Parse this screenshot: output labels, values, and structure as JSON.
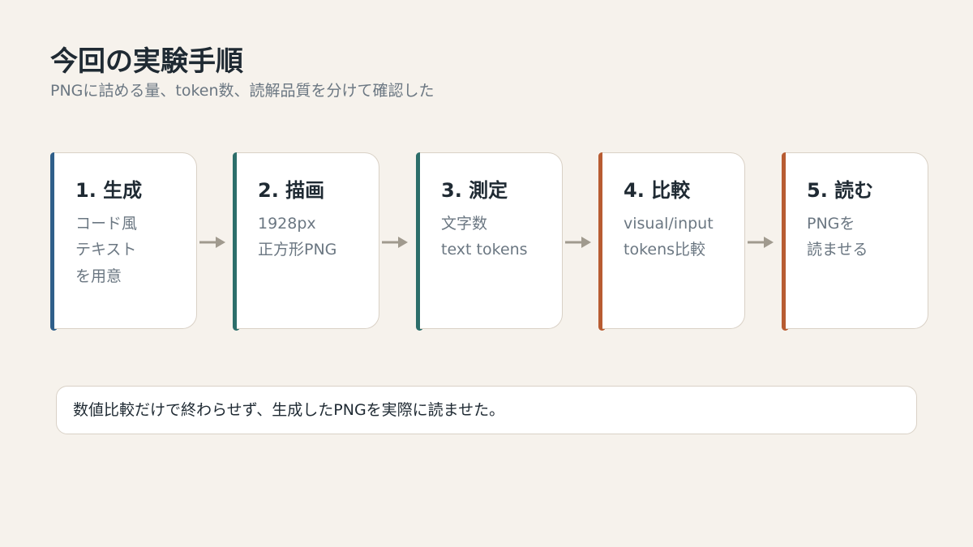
{
  "header": {
    "title": "今回の実験手順",
    "subtitle": "PNGに詰める量、token数、読解品質を分けて確認した"
  },
  "steps": [
    {
      "title": "1. 生成",
      "lines": [
        "コード風",
        "テキスト",
        "を用意"
      ],
      "accent": "#2f5f8a"
    },
    {
      "title": "2. 描画",
      "lines": [
        "1928px",
        "正方形PNG"
      ],
      "accent": "#2c6e6a"
    },
    {
      "title": "3. 測定",
      "lines": [
        "文字数",
        "text tokens"
      ],
      "accent": "#2c6e6a"
    },
    {
      "title": "4. 比較",
      "lines": [
        "visual/input",
        "tokens比較"
      ],
      "accent": "#b85c32"
    },
    {
      "title": "5. 読む",
      "lines": [
        "PNGを",
        "読ませる"
      ],
      "accent": "#b85c32"
    }
  ],
  "icons": {
    "connector": "arrow-right-icon",
    "arrow_color": "#a09a8e"
  },
  "note": {
    "text": "数値比較だけで終わらせず、生成したPNGを実際に読ませた。"
  }
}
